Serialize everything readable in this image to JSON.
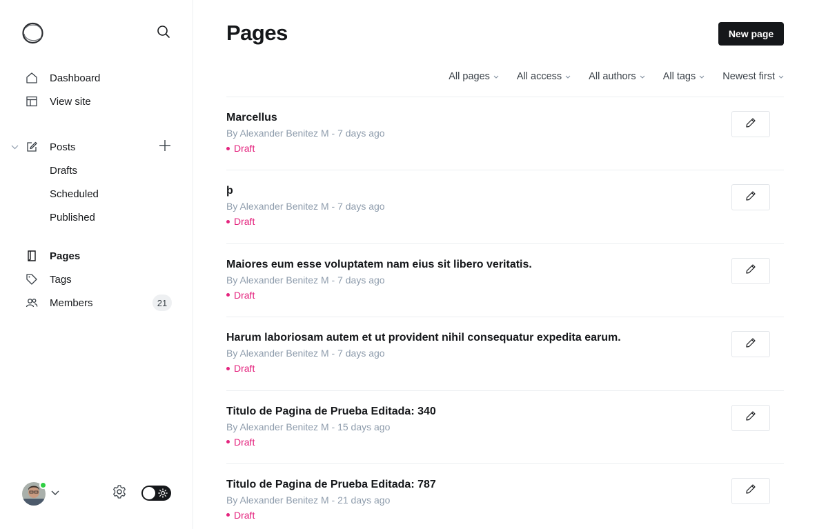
{
  "sidebar": {
    "nav": [
      {
        "label": "Dashboard",
        "icon": "home-icon"
      },
      {
        "label": "View site",
        "icon": "layout-icon"
      }
    ],
    "posts": {
      "label": "Posts",
      "icon": "edit-icon",
      "sub_items": [
        "Drafts",
        "Scheduled",
        "Published"
      ]
    },
    "secondary": [
      {
        "label": "Pages",
        "icon": "page-icon",
        "active": true
      },
      {
        "label": "Tags",
        "icon": "tag-icon"
      },
      {
        "label": "Members",
        "icon": "members-icon",
        "count": "21"
      }
    ]
  },
  "header": {
    "title": "Pages",
    "new_button": "New page"
  },
  "filters": [
    "All pages",
    "All access",
    "All authors",
    "All tags",
    "Newest first"
  ],
  "pages": [
    {
      "title": "Marcellus",
      "meta": "By Alexander Benitez M - 7 days ago",
      "status": "Draft"
    },
    {
      "title": "ϸ",
      "meta": "By Alexander Benitez M - 7 days ago",
      "status": "Draft"
    },
    {
      "title": "Maiores eum esse voluptatem nam eius sit libero veritatis.",
      "meta": "By Alexander Benitez M - 7 days ago",
      "status": "Draft"
    },
    {
      "title": "Harum laboriosam autem et ut provident nihil consequatur expedita earum.",
      "meta": "By Alexander Benitez M - 7 days ago",
      "status": "Draft"
    },
    {
      "title": "Titulo de Pagina de Prueba Editada: 340",
      "meta": "By Alexander Benitez M - 15 days ago",
      "status": "Draft"
    },
    {
      "title": "Titulo de Pagina de Prueba Editada: 787",
      "meta": "By Alexander Benitez M - 21 days ago",
      "status": "Draft"
    }
  ],
  "colors": {
    "accent_draft": "#e4247e",
    "primary_dark": "#15171a",
    "online": "#30cf43"
  }
}
